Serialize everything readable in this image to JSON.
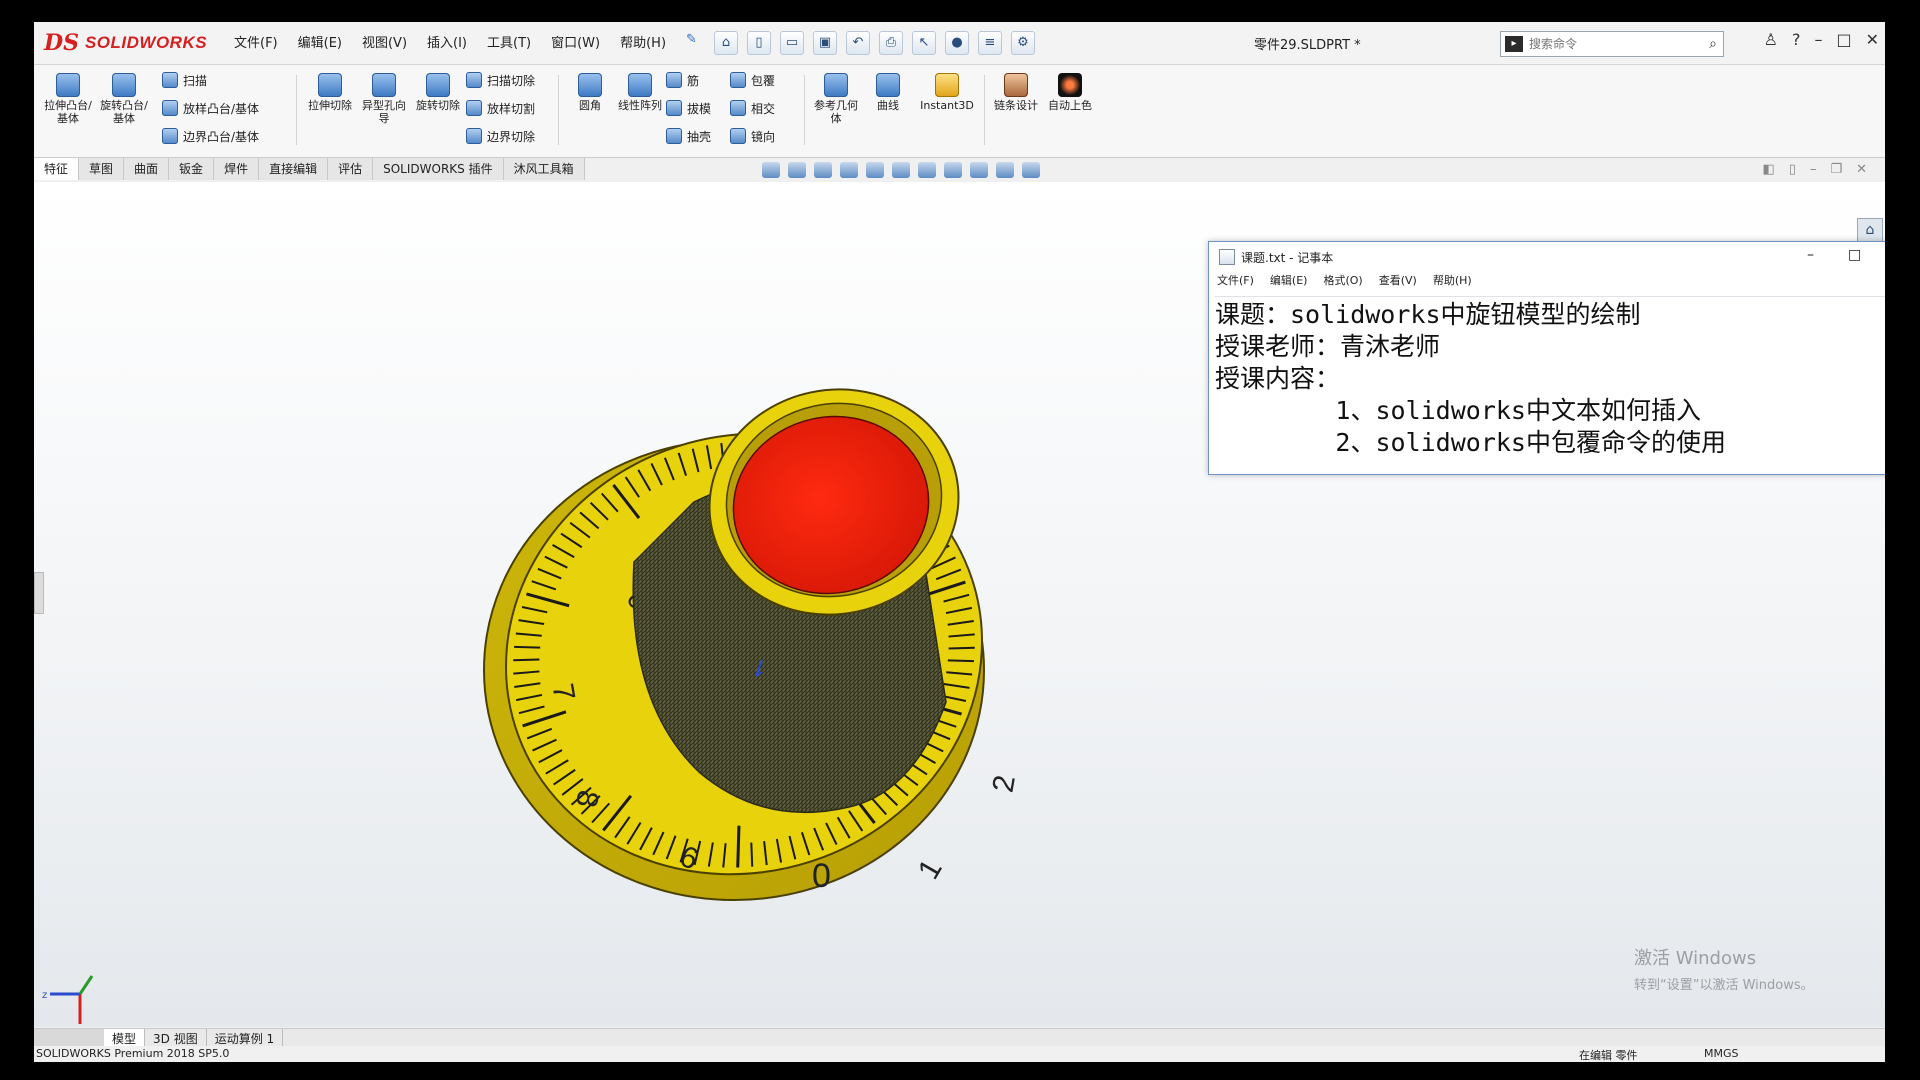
{
  "app": {
    "logo_prefix": "DS",
    "logo_name": "SOLIDWORKS",
    "menu": [
      "文件(F)",
      "编辑(E)",
      "视图(V)",
      "插入(I)",
      "工具(T)",
      "窗口(W)",
      "帮助(H)"
    ],
    "doc_title": "零件29.SLDPRT *",
    "search_placeholder": "搜索命令"
  },
  "ribbon": {
    "extrude_boss": "拉伸凸台/基体",
    "revolve_boss": "旋转凸台/基体",
    "sweep": "扫描",
    "loft_boss": "放样凸台/基体",
    "boundary_boss": "边界凸台/基体",
    "extrude_cut": "拉伸切除",
    "hole_wizard": "异型孔向导",
    "revolve_cut": "旋转切除",
    "sweep_cut": "扫描切除",
    "loft_cut": "放样切割",
    "boundary_cut": "边界切除",
    "fillet": "圆角",
    "linear_pattern": "线性阵列",
    "rib": "筋",
    "draft": "拔模",
    "shell": "抽壳",
    "wrap": "包覆",
    "intersect": "相交",
    "mirror": "镜向",
    "ref_geometry": "参考几何体",
    "curves": "曲线",
    "instant3d": "Instant3D",
    "chain_design": "链条设计",
    "auto_color": "自动上色"
  },
  "tabs": [
    "特征",
    "草图",
    "曲面",
    "钣金",
    "焊件",
    "直接编辑",
    "评估",
    "SOLIDWORKS 插件",
    "沐风工具箱"
  ],
  "dial_labels": [
    "0",
    "1",
    "2",
    "6",
    "7",
    "8",
    "6"
  ],
  "notepad": {
    "title": "课题.txt - 记事本",
    "menu": [
      "文件(F)",
      "编辑(E)",
      "格式(O)",
      "查看(V)",
      "帮助(H)"
    ],
    "lines": [
      "课题：solidworks中旋钮模型的绘制",
      "授课老师：青沐老师",
      "授课内容：",
      "        1、solidworks中文本如何插入",
      "        2、solidworks中包覆命令的使用"
    ]
  },
  "bottom_tabs": [
    "模型",
    "3D 视图",
    "运动算例 1"
  ],
  "status": {
    "product": "SOLIDWORKS Premium 2018 SP5.0",
    "editing": "在编辑 零件",
    "units": "MMGS"
  },
  "watermark": {
    "line1": "激活 Windows",
    "line2": "转到“设置”以激活 Windows。"
  },
  "colors": {
    "knob_yellow": "#e8d20c",
    "knob_red": "#e21a0a",
    "knurl_dark": "#4a4a2e",
    "logo_red": "#d62020"
  }
}
